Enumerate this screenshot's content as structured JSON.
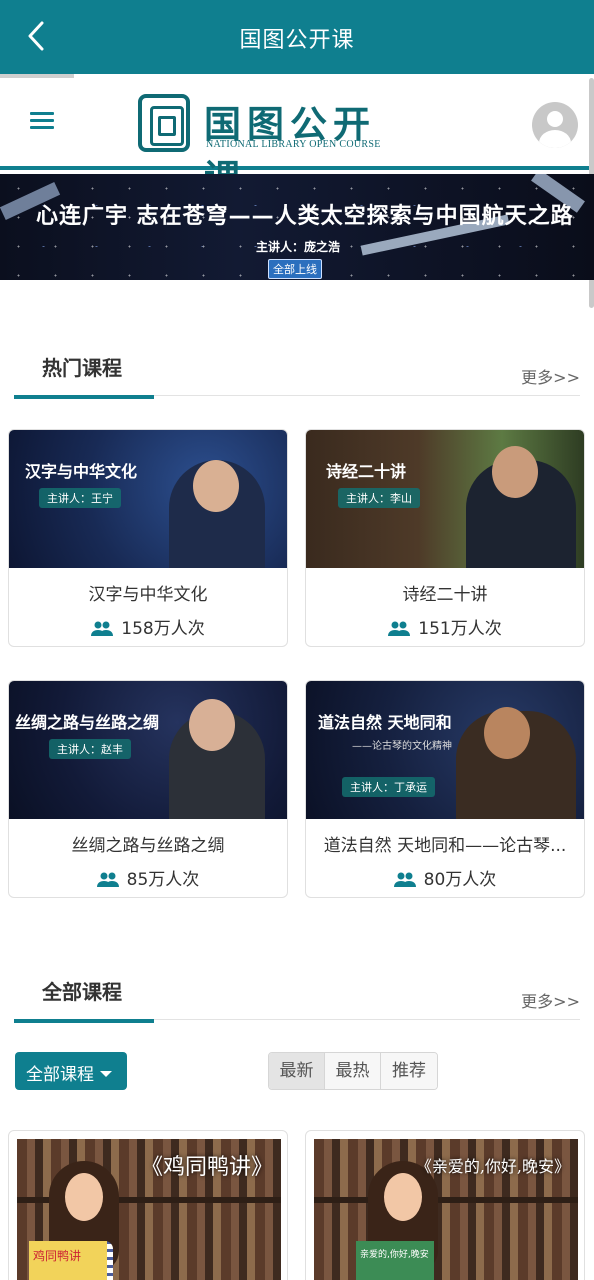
{
  "appbar": {
    "title": "国图公开课"
  },
  "site": {
    "logo_cn": "国图公开课",
    "logo_en": "NATIONAL LIBRARY OPEN COURSE"
  },
  "banner": {
    "headline": "心连广宇 志在苍穹——人类太空探索与中国航天之路",
    "host": "主讲人：庞之浩",
    "badge": "全部上线"
  },
  "hot": {
    "title": "热门课程",
    "more": "更多>>",
    "courses": [
      {
        "thumb_title": "汉字与中华文化",
        "speaker": "主讲人：王宁",
        "name": "汉字与中华文化",
        "views": "158万人次"
      },
      {
        "thumb_title": "诗经二十讲",
        "speaker": "主讲人：李山",
        "name": "诗经二十讲",
        "views": "151万人次"
      },
      {
        "thumb_title": "丝绸之路与丝路之绸",
        "speaker": "主讲人：赵丰",
        "name": "丝绸之路与丝路之绸",
        "views": "85万人次"
      },
      {
        "thumb_title": "道法自然 天地同和",
        "thumb_subtitle": "——论古琴的文化精神",
        "speaker": "主讲人：丁承运",
        "name": "道法自然 天地同和——论古琴...",
        "views": "80万人次"
      }
    ]
  },
  "all": {
    "title": "全部课程",
    "more": "更多>>",
    "filter": "全部课程",
    "sort_tabs": [
      "最新",
      "最热",
      "推荐"
    ],
    "active_sort": "最新",
    "courses": [
      {
        "thumb_title": "《鸡同鸭讲》",
        "book_text": "鸡同鸭讲"
      },
      {
        "thumb_title": "《亲爱的,你好,晚安》",
        "book_text": "亲爱的,你好,晚安"
      }
    ]
  },
  "colors": {
    "primary": "#0f7f8f",
    "seal": "#0f6a74"
  },
  "icons": [
    "back-arrow-icon",
    "menu-icon",
    "user-avatar-icon",
    "people-icon",
    "caret-down-icon"
  ]
}
